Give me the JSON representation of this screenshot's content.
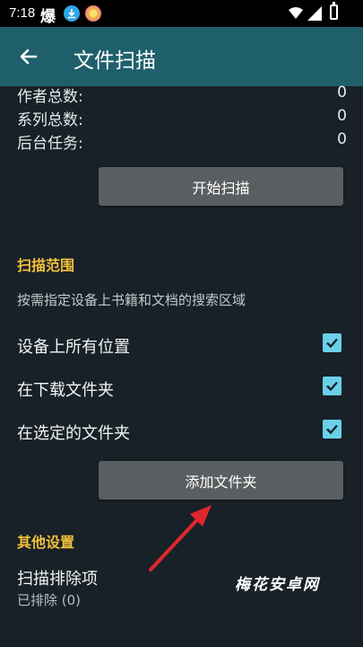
{
  "status_bar": {
    "time": "7:18",
    "notif_text": "爆"
  },
  "app_bar": {
    "title": "文件扫描"
  },
  "stats": [
    {
      "label": "作者总数:",
      "value": "0"
    },
    {
      "label": "系列总数:",
      "value": "0"
    },
    {
      "label": "后台任务:",
      "value": "0"
    }
  ],
  "start_scan_label": "开始扫描",
  "scan_scope": {
    "title": "扫描范围",
    "description": "按需指定设备上书籍和文档的搜索区域",
    "options": [
      {
        "label": "设备上所有位置",
        "checked": true
      },
      {
        "label": "在下载文件夹",
        "checked": true
      },
      {
        "label": "在选定的文件夹",
        "checked": true
      }
    ],
    "add_folder_label": "添加文件夹"
  },
  "other_settings": {
    "title": "其他设置",
    "exclusions_title": "扫描排除项",
    "exclusions_summary": "已排除 (0)"
  },
  "watermark": "梅花安卓网",
  "colors": {
    "background": "#172127",
    "app_bar": "#1f5f6b",
    "accent": "#f3c13a",
    "checkbox": "#6ad0e8",
    "button": "#5b5e60",
    "annotation_arrow": "#e0272d"
  }
}
